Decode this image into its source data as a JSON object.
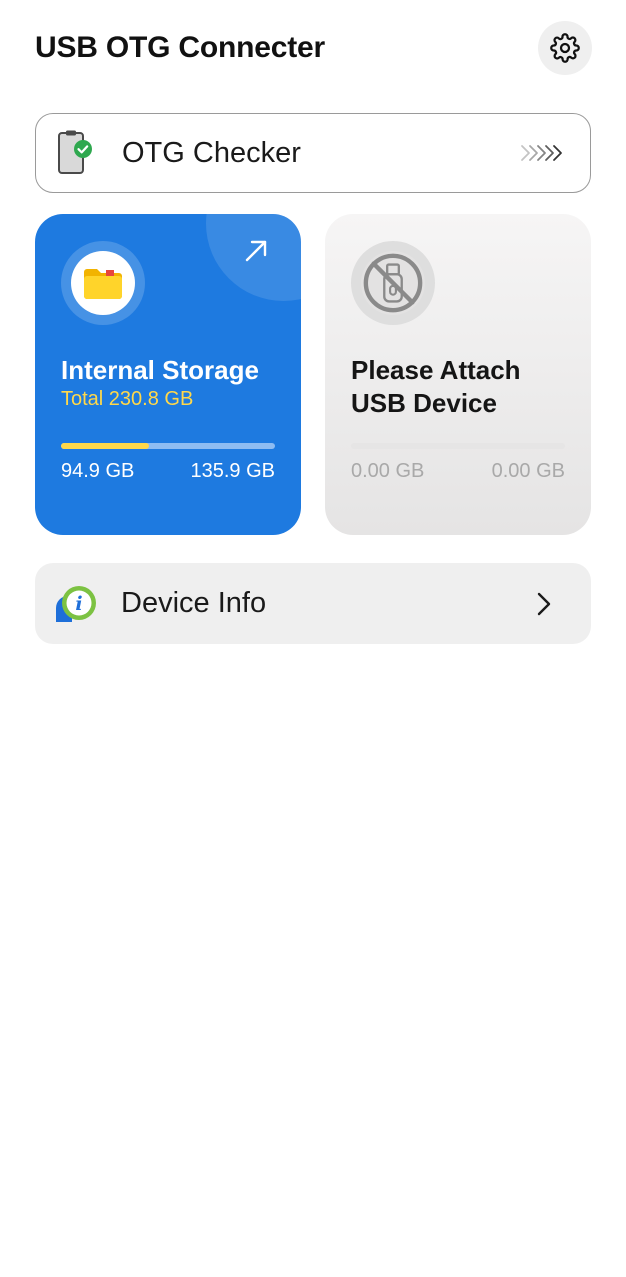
{
  "header": {
    "title": "USB OTG Connecter",
    "settings_icon": "gear-icon"
  },
  "otg_checker": {
    "label": "OTG Checker",
    "icon": "phone-check-icon",
    "arrow_icon": "chevrons-right-icon"
  },
  "internal_storage": {
    "title": "Internal Storage",
    "total": "Total 230.8 GB",
    "used": "94.9 GB",
    "free": "135.9 GB",
    "used_fraction": 0.41,
    "icon": "folder-icon",
    "open_icon": "arrow-up-right-icon",
    "color": "#1e7ae0",
    "accent": "#ffd84a"
  },
  "usb_device": {
    "title": "Please Attach USB Device",
    "used": "0.00 GB",
    "free": "0.00 GB",
    "used_fraction": 0,
    "icon": "usb-disabled-icon"
  },
  "device_info": {
    "label": "Device Info",
    "icon": "info-bubble-icon",
    "chevron_icon": "chevron-right-icon"
  }
}
